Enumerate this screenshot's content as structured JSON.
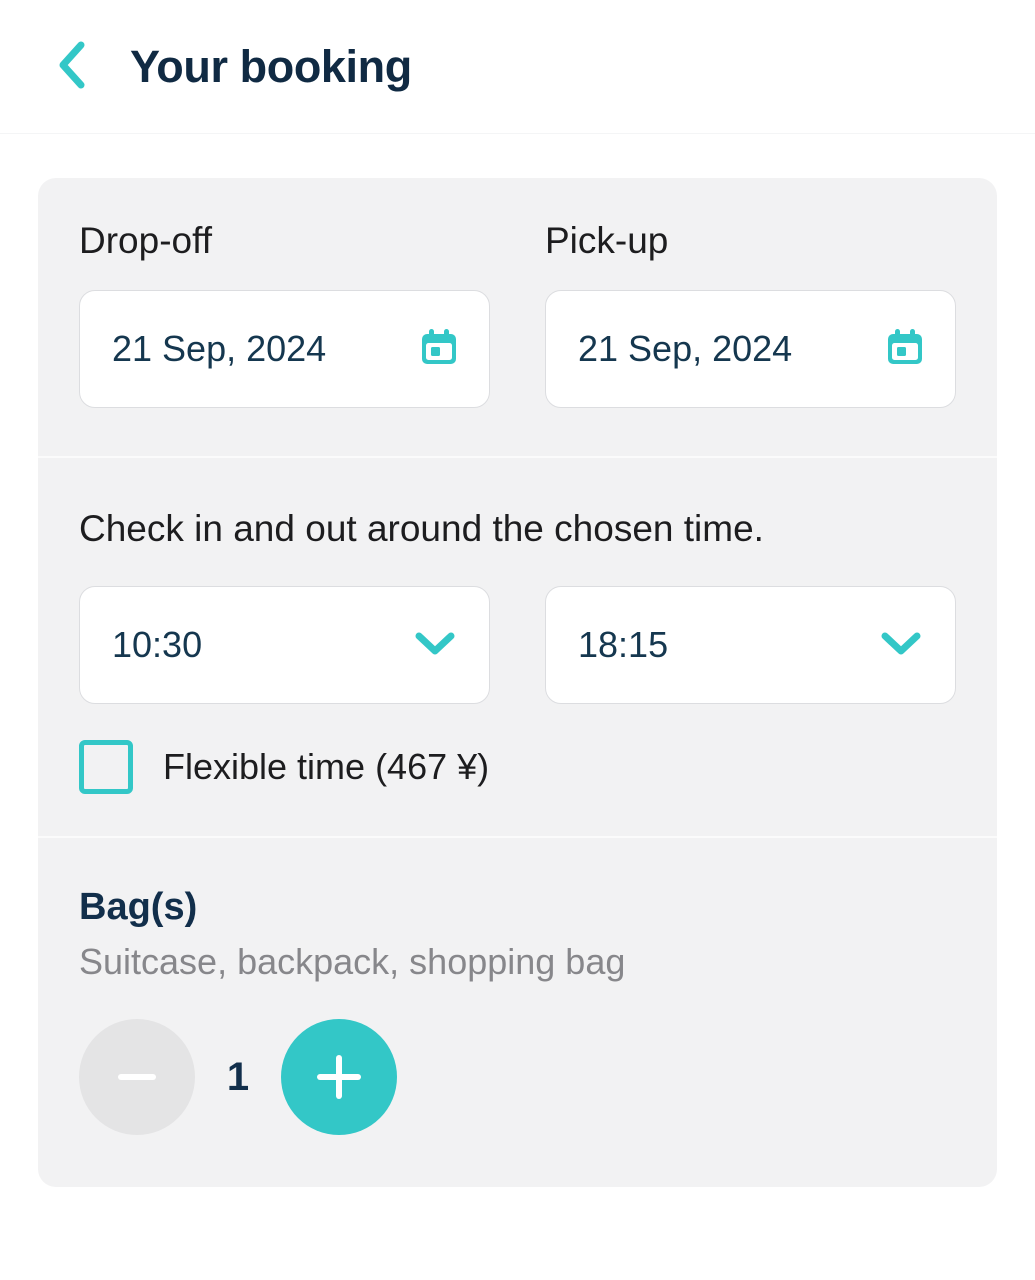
{
  "header": {
    "back_icon": "chevron-left-icon",
    "title": "Your booking"
  },
  "booking": {
    "dropoff": {
      "label": "Drop-off",
      "date": "21 Sep, 2024",
      "icon": "calendar-icon"
    },
    "pickup": {
      "label": "Pick-up",
      "date": "21 Sep, 2024",
      "icon": "calendar-icon"
    },
    "time": {
      "helper_text": "Check in and out around the chosen time.",
      "checkin": "10:30",
      "checkout": "18:15",
      "dropdown_icon": "chevron-down-icon",
      "flexible_label": "Flexible time (467 ¥)",
      "flexible_checked": false
    },
    "bags": {
      "title": "Bag(s)",
      "subtitle": "Suitcase, backpack, shopping bag",
      "count": "1",
      "decrease_icon": "minus-icon",
      "increase_icon": "plus-icon"
    }
  },
  "colors": {
    "accent": "#33c7c7",
    "title": "#102a43",
    "card_bg": "#f2f2f3",
    "muted": "#87878b"
  }
}
